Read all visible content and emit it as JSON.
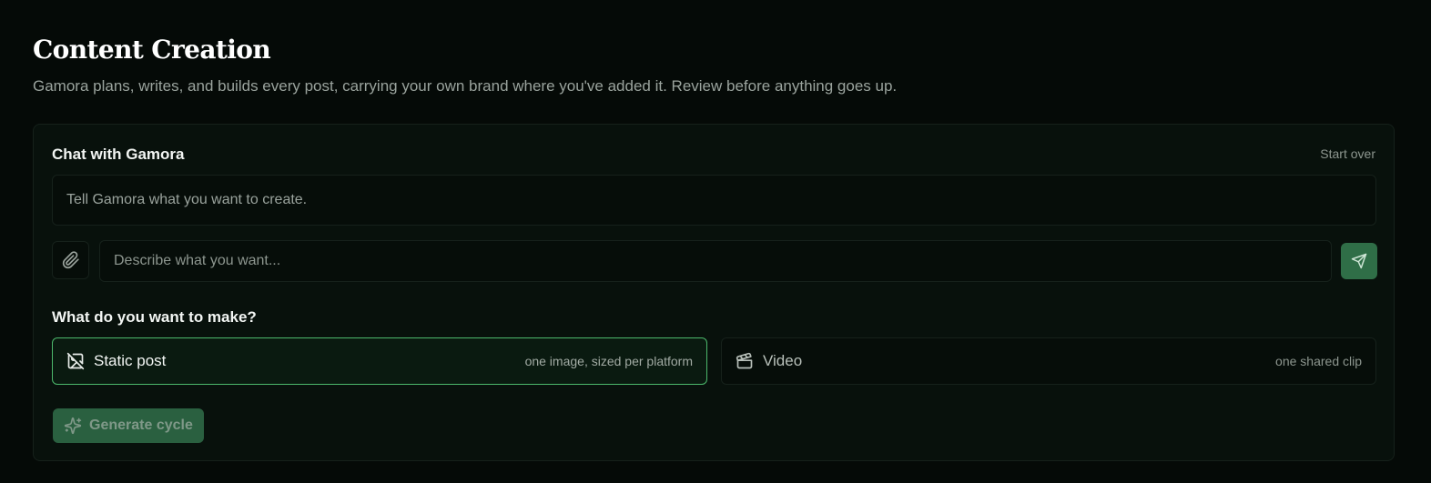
{
  "page": {
    "title": "Content Creation",
    "subtitle": "Gamora plans, writes, and builds every post, carrying your own brand where you've added it. Review before anything goes up."
  },
  "chat": {
    "heading": "Chat with Gamora",
    "start_over": "Start over",
    "intro_message": "Tell Gamora what you want to create.",
    "input_value": "",
    "input_placeholder": "Describe what you want...",
    "attach_icon": "paperclip-icon",
    "send_icon": "send-icon"
  },
  "make": {
    "heading": "What do you want to make?",
    "options": [
      {
        "label": "Static post",
        "hint": "one image, sized per platform",
        "icon": "image-off-icon",
        "selected": true
      },
      {
        "label": "Video",
        "hint": "one shared clip",
        "icon": "clapperboard-icon",
        "selected": false
      }
    ]
  },
  "actions": {
    "generate_label": "Generate cycle",
    "generate_icon": "sparkles-icon",
    "generate_enabled": false
  },
  "colors": {
    "background": "#050a07",
    "panel": "#08110c",
    "accent": "#4cb86c",
    "button_green": "#2f6e47"
  }
}
